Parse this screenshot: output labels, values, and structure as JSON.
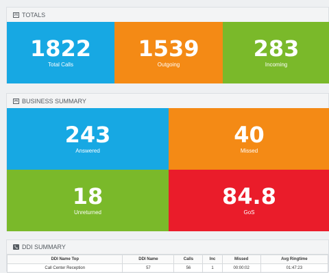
{
  "totals": {
    "header": "TOTALS",
    "tiles": [
      {
        "value": "1822",
        "label": "Total Calls",
        "color": "#17a8e3"
      },
      {
        "value": "1539",
        "label": "Outgoing",
        "color": "#f48a15"
      },
      {
        "value": "283",
        "label": "Incoming",
        "color": "#7ab92a"
      }
    ]
  },
  "business": {
    "header": "BUSINESS SUMMARY",
    "tiles": [
      {
        "value": "243",
        "label": "Answered",
        "color": "#17a8e3"
      },
      {
        "value": "40",
        "label": "Missed",
        "color": "#f48a15"
      },
      {
        "value": "18",
        "label": "Unreturned",
        "color": "#7ab92a"
      },
      {
        "value": "84.8",
        "label": "GoS",
        "color": "#ea1c2a"
      }
    ]
  },
  "ddi": {
    "header": "DDI SUMMARY",
    "columns": [
      "DDI Name Top",
      "DDI Name",
      "Calls",
      "Inc",
      "Missed",
      "Avg Ringtime"
    ],
    "rows": [
      [
        "Call Center Reception",
        "57",
        "56",
        "1",
        "00:00:02",
        "01:47:23"
      ]
    ]
  }
}
